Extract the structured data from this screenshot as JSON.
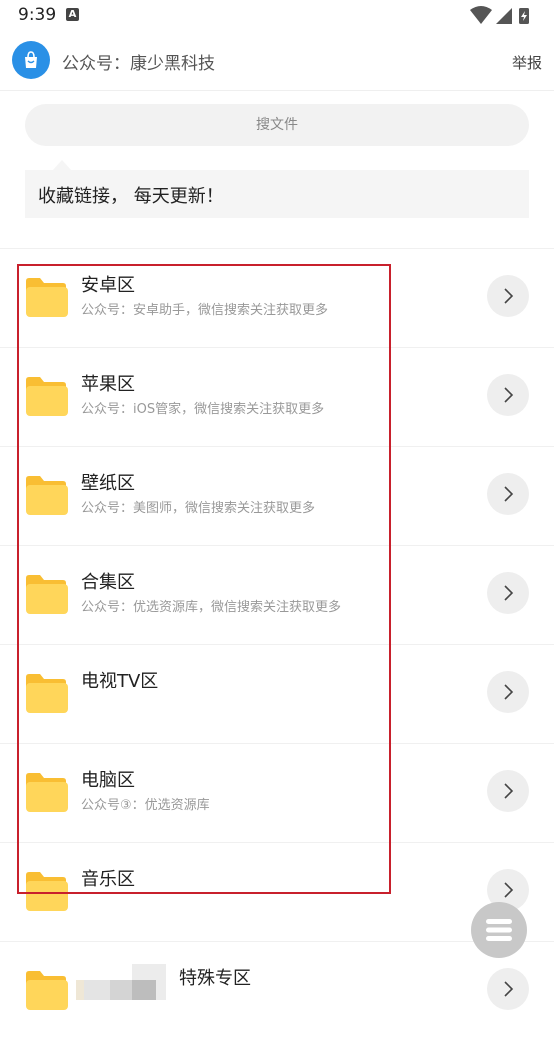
{
  "status_bar": {
    "time": "9:39",
    "notification_letter": "A"
  },
  "header": {
    "title": "公众号：康少黑科技",
    "report_label": "举报"
  },
  "search": {
    "placeholder": "搜文件"
  },
  "notice": {
    "text": "收藏链接， 每天更新！"
  },
  "folders": [
    {
      "title": "安卓区",
      "subtitle": "公众号：安卓助手，微信搜索关注获取更多"
    },
    {
      "title": "苹果区",
      "subtitle": "公众号：iOS管家，微信搜索关注获取更多"
    },
    {
      "title": "壁纸区",
      "subtitle": "公众号：美图师，微信搜索关注获取更多"
    },
    {
      "title": "合集区",
      "subtitle": "公众号：优选资源库，微信搜索关注获取更多"
    },
    {
      "title": "电视TV区",
      "subtitle": ""
    },
    {
      "title": "电脑区",
      "subtitle": "公众号③：优选资源库"
    },
    {
      "title": "音乐区",
      "subtitle": ""
    },
    {
      "title": "特殊专区",
      "subtitle": ""
    }
  ],
  "colors": {
    "folder": "#ffd65a",
    "folder_tab": "#f9be33",
    "highlight": "#c8202c",
    "logo": "#2a90e6",
    "fab": "#c8c8c8"
  },
  "icons": {
    "folder": "folder-icon",
    "chevron": "chevron-right-icon",
    "menu": "menu-icon",
    "logo": "shopping-bag-icon"
  }
}
